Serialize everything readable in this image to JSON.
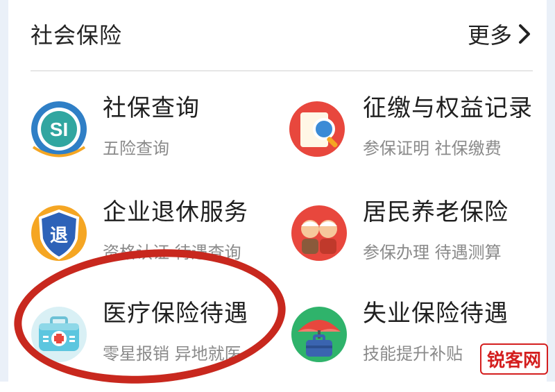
{
  "header": {
    "title": "社会保险",
    "more_label": "更多"
  },
  "items": [
    {
      "title": "社保查询",
      "subtitle": "五险查询",
      "icon": "si-badge-icon"
    },
    {
      "title": "征缴与权益记录",
      "subtitle": "参保证明 社保缴费",
      "icon": "magnifier-document-icon"
    },
    {
      "title": "企业退休服务",
      "subtitle": "资格认证 待遇查询",
      "icon": "retire-shield-icon"
    },
    {
      "title": "居民养老保险",
      "subtitle": "参保办理 待遇测算",
      "icon": "elderly-couple-icon"
    },
    {
      "title": "医疗保险待遇",
      "subtitle": "零星报销 异地就医",
      "icon": "medical-kit-icon"
    },
    {
      "title": "失业保险待遇",
      "subtitle": "技能提升补贴",
      "icon": "umbrella-briefcase-icon"
    }
  ],
  "colors": {
    "highlight_circle": "#c8281e",
    "watermark": "#d41e1e"
  },
  "watermark": {
    "text": "锐客网"
  }
}
